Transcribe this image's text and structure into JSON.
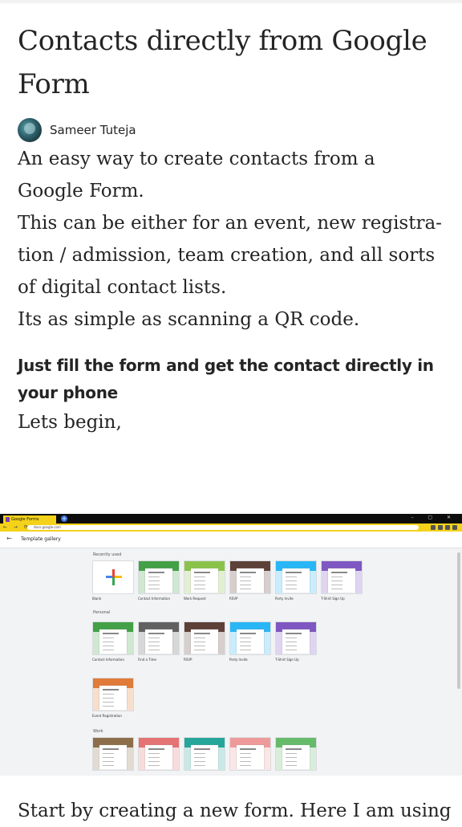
{
  "article": {
    "title": "Contacts directly from Google Form",
    "author": "Sameer Tuteja",
    "paragraph_1": "An easy way to create contacts from a Google Form.",
    "paragraph_2": "This can be either for an event, new registra-tion / admission, team creation, and all sorts of digital contact lists.",
    "paragraph_3": "Its as simple as scanning a QR code.",
    "bold_line": "Just fill the form and get the contact directly in your phone",
    "paragraph_4": "Lets begin,",
    "paragraph_5_partial": "Start by creating a new form. Here I am using"
  },
  "screenshot": {
    "tab_title": "Google Forms",
    "url": "docs.google.com",
    "page_title": "Template gallery",
    "sections": [
      {
        "label": "Recently used",
        "tiles": [
          {
            "label": "Blank",
            "kind": "blank",
            "color": "#ffffff"
          },
          {
            "label": "Contact Information",
            "kind": "form",
            "color": "#43a047"
          },
          {
            "label": "Work Request",
            "kind": "form",
            "color": "#8bc34a"
          },
          {
            "label": "RSVP",
            "kind": "form",
            "color": "#5d4037"
          },
          {
            "label": "Party Invite",
            "kind": "form",
            "color": "#29b6f6"
          },
          {
            "label": "T-Shirt Sign Up",
            "kind": "form",
            "color": "#7e57c2"
          }
        ]
      },
      {
        "label": "Personal",
        "tiles": [
          {
            "label": "Contact Information",
            "kind": "form",
            "color": "#43a047"
          },
          {
            "label": "Find a Time",
            "kind": "form",
            "color": "#616161"
          },
          {
            "label": "RSVP",
            "kind": "form",
            "color": "#5d4037"
          },
          {
            "label": "Party Invite",
            "kind": "form",
            "color": "#29b6f6"
          },
          {
            "label": "T-Shirt Sign Up",
            "kind": "form",
            "color": "#7e57c2"
          },
          {
            "label": "Event Registration",
            "kind": "form",
            "color": "#e07b39"
          }
        ]
      },
      {
        "label": "Work",
        "tiles": [
          {
            "label": "",
            "kind": "form",
            "color": "#8d6e4a"
          },
          {
            "label": "",
            "kind": "form",
            "color": "#e57373"
          },
          {
            "label": "",
            "kind": "form",
            "color": "#26a69a"
          },
          {
            "label": "",
            "kind": "form",
            "color": "#ef9a9a"
          },
          {
            "label": "",
            "kind": "form",
            "color": "#66bb6a"
          }
        ]
      }
    ]
  }
}
